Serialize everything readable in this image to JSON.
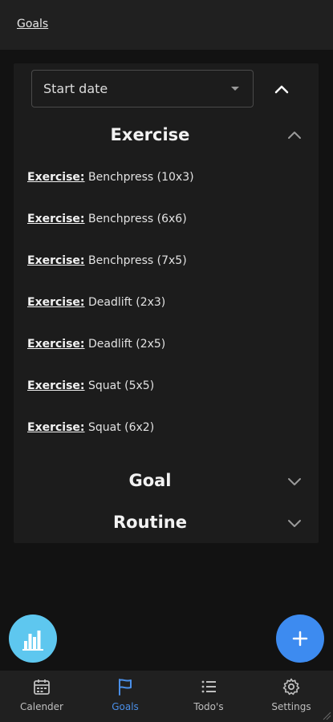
{
  "header": {
    "title": "Goals"
  },
  "filter": {
    "select_value": "Start date"
  },
  "sections": {
    "exercise": {
      "label": "Exercise",
      "items": [
        {
          "key": "Exercise:",
          "value": "Benchpress (10x3)"
        },
        {
          "key": "Exercise:",
          "value": "Benchpress (6x6)"
        },
        {
          "key": "Exercise:",
          "value": "Benchpress (7x5)"
        },
        {
          "key": "Exercise:",
          "value": "Deadlift (2x3)"
        },
        {
          "key": "Exercise:",
          "value": "Deadlift (2x5)"
        },
        {
          "key": "Exercise:",
          "value": "Squat (5x5)"
        },
        {
          "key": "Exercise:",
          "value": "Squat (6x2)"
        }
      ]
    },
    "goal": {
      "label": "Goal"
    },
    "routine": {
      "label": "Routine"
    }
  },
  "nav": {
    "items": [
      {
        "label": "Calender",
        "icon": "calendar-icon"
      },
      {
        "label": "Goals",
        "icon": "flag-icon"
      },
      {
        "label": "Todo's",
        "icon": "list-icon"
      },
      {
        "label": "Settings",
        "icon": "gear-icon"
      }
    ],
    "active": "Goals"
  },
  "colors": {
    "accent": "#4a8fe8",
    "fab_stats": "#5ec7ef",
    "fab_add": "#3d8bf0",
    "background": "#121212",
    "panel": "#1c1c1c"
  }
}
